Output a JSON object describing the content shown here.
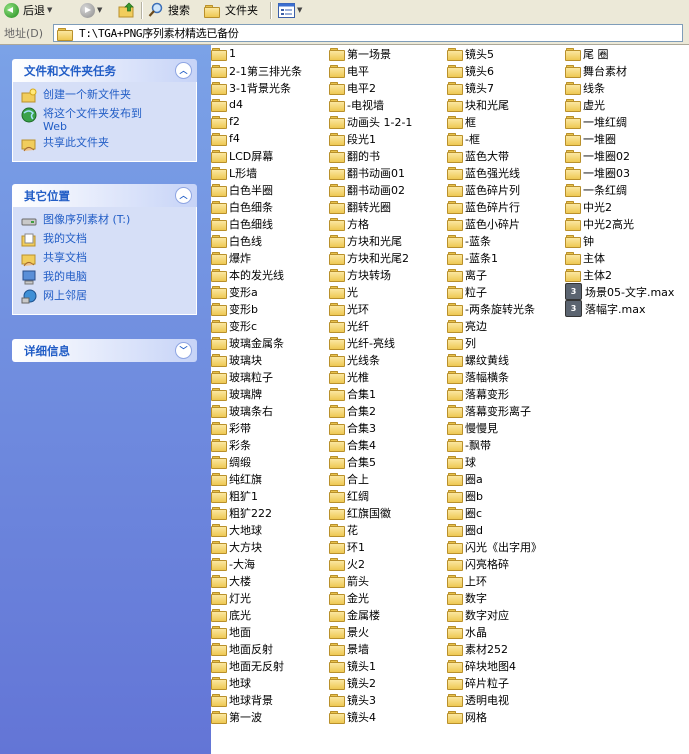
{
  "toolbar": {
    "back_label": "后退",
    "search_label": "搜索",
    "folders_label": "文件夹"
  },
  "address": {
    "label": "地址(D)",
    "path": "T:\\TGA+PNG序列素材精选已备份"
  },
  "sidebar": {
    "tasks": {
      "title": "文件和文件夹任务",
      "items": [
        {
          "label": "创建一个新文件夹",
          "icon": "new-folder-icon"
        },
        {
          "label": "将这个文件夹发布到",
          "label2": "Web",
          "icon": "publish-web-icon"
        },
        {
          "label": "共享此文件夹",
          "icon": "share-folder-icon"
        }
      ]
    },
    "places": {
      "title": "其它位置",
      "items": [
        {
          "label": "图像序列素材 (T:)",
          "icon": "drive-icon"
        },
        {
          "label": "我的文档",
          "icon": "my-documents-icon"
        },
        {
          "label": "共享文档",
          "icon": "shared-documents-icon"
        },
        {
          "label": "我的电脑",
          "icon": "my-computer-icon"
        },
        {
          "label": "网上邻居",
          "icon": "network-icon"
        }
      ]
    },
    "details": {
      "title": "详细信息"
    }
  },
  "files": {
    "columns": [
      [
        "1",
        "2-1第三排光条",
        "3-1背景光条",
        "d4",
        "f2",
        "f4",
        "LCD屏幕",
        "L形墙",
        "白色半圈",
        "白色细条",
        "白色细线",
        "白色线",
        "爆炸",
        "本的发光线",
        "变形a",
        "变形b",
        "变形c",
        "玻璃金属条",
        "玻璃块",
        "玻璃粒子",
        "玻璃牌",
        "玻璃条右",
        "彩带",
        "彩条",
        "绸缎",
        "纯红旗",
        "粗犷1",
        "粗犷222",
        "大地球",
        "大方块",
        "-大海",
        "大楼",
        "灯光",
        "底光",
        "地面",
        "地面反射",
        "地面无反射",
        "地球",
        "地球背景",
        "第一波"
      ],
      [
        "第一场景",
        "电平",
        "电平2",
        "-电视墙",
        "动画头 1-2-1",
        "段光1",
        "翻的书",
        "翻书动画01",
        "翻书动画02",
        "翻转光圈",
        "方格",
        "方块和光尾",
        "方块和光尾2",
        "方块转场",
        "光",
        "光环",
        "光纤",
        "光纤-亮线",
        "光线条",
        "光椎",
        "合集1",
        "合集2",
        "合集3",
        "合集4",
        "合集5",
        "合上",
        "红绸",
        "红旗国徽",
        "花",
        "环1",
        "火2",
        "箭头",
        "金光",
        "金属楼",
        "景火",
        "景墙",
        "镜头1",
        "镜头2",
        "镜头3",
        "镜头4"
      ],
      [
        "镜头5",
        "镜头6",
        "镜头7",
        "块和光尾",
        "框",
        "-框",
        "蓝色大带",
        "蓝色强光线",
        "蓝色碎片列",
        "蓝色碎片行",
        "蓝色小碎片",
        "-蓝条",
        "-蓝条1",
        "离子",
        "粒子",
        "-两条旋转光条",
        "亮边",
        "列",
        "螺纹黄线",
        "落幅横条",
        "落幕变形",
        "落幕变形离子",
        "慢慢見",
        "-飘带",
        "球",
        "圈a",
        "圈b",
        "圈c",
        "圈d",
        "闪光《出字用》",
        "闪亮格碎",
        "上环",
        "数字",
        "数字对应",
        "水晶",
        "素材252",
        "碎块地图4",
        "碎片粒子",
        "透明电视",
        "网格"
      ],
      [
        "尾 圈",
        "舞台素材",
        "线条",
        "虚光",
        "一堆红绸",
        "一堆圈",
        "一堆圈02",
        "一堆圈03",
        "一条红绸",
        "中光2",
        "中光2高光",
        "钟",
        "主体",
        "主体2"
      ]
    ],
    "max_files": [
      "场景05-文字.max",
      "落幅字.max"
    ]
  }
}
